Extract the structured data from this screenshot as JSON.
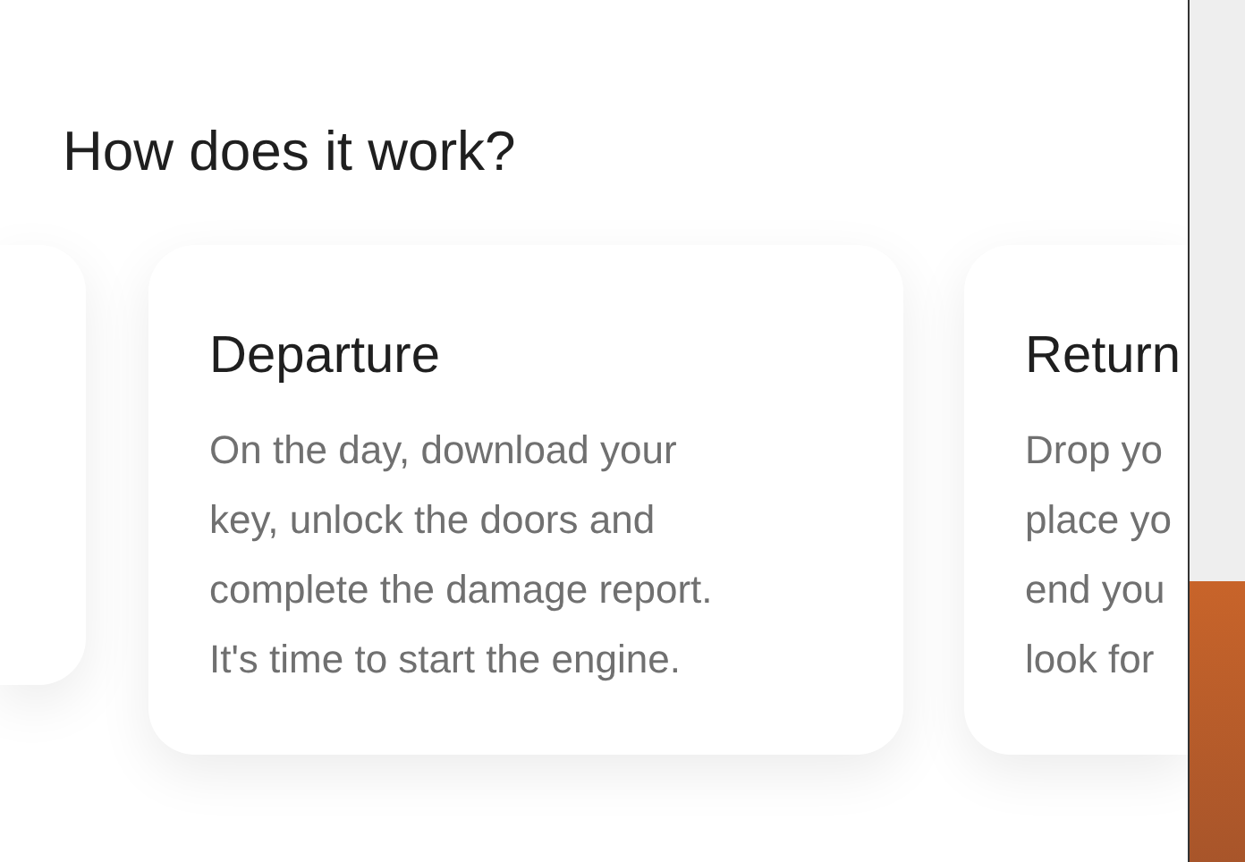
{
  "heading": "How does it work?",
  "steps": [
    {
      "title": "Departure",
      "text": "On the day, download your key, unlock the doors and complete the damage report. It's time to start the engine."
    },
    {
      "title": "Return",
      "text": "Drop yo\nplace yo\nend you\nlook for"
    }
  ]
}
